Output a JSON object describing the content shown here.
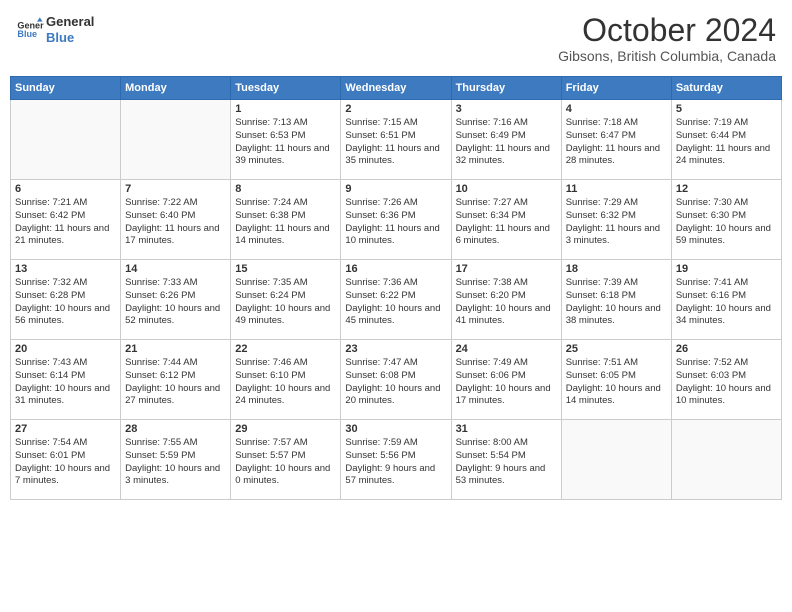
{
  "header": {
    "logo_line1": "General",
    "logo_line2": "Blue",
    "month": "October 2024",
    "location": "Gibsons, British Columbia, Canada"
  },
  "weekdays": [
    "Sunday",
    "Monday",
    "Tuesday",
    "Wednesday",
    "Thursday",
    "Friday",
    "Saturday"
  ],
  "weeks": [
    [
      {
        "day": "",
        "info": ""
      },
      {
        "day": "",
        "info": ""
      },
      {
        "day": "1",
        "info": "Sunrise: 7:13 AM\nSunset: 6:53 PM\nDaylight: 11 hours and 39 minutes."
      },
      {
        "day": "2",
        "info": "Sunrise: 7:15 AM\nSunset: 6:51 PM\nDaylight: 11 hours and 35 minutes."
      },
      {
        "day": "3",
        "info": "Sunrise: 7:16 AM\nSunset: 6:49 PM\nDaylight: 11 hours and 32 minutes."
      },
      {
        "day": "4",
        "info": "Sunrise: 7:18 AM\nSunset: 6:47 PM\nDaylight: 11 hours and 28 minutes."
      },
      {
        "day": "5",
        "info": "Sunrise: 7:19 AM\nSunset: 6:44 PM\nDaylight: 11 hours and 24 minutes."
      }
    ],
    [
      {
        "day": "6",
        "info": "Sunrise: 7:21 AM\nSunset: 6:42 PM\nDaylight: 11 hours and 21 minutes."
      },
      {
        "day": "7",
        "info": "Sunrise: 7:22 AM\nSunset: 6:40 PM\nDaylight: 11 hours and 17 minutes."
      },
      {
        "day": "8",
        "info": "Sunrise: 7:24 AM\nSunset: 6:38 PM\nDaylight: 11 hours and 14 minutes."
      },
      {
        "day": "9",
        "info": "Sunrise: 7:26 AM\nSunset: 6:36 PM\nDaylight: 11 hours and 10 minutes."
      },
      {
        "day": "10",
        "info": "Sunrise: 7:27 AM\nSunset: 6:34 PM\nDaylight: 11 hours and 6 minutes."
      },
      {
        "day": "11",
        "info": "Sunrise: 7:29 AM\nSunset: 6:32 PM\nDaylight: 11 hours and 3 minutes."
      },
      {
        "day": "12",
        "info": "Sunrise: 7:30 AM\nSunset: 6:30 PM\nDaylight: 10 hours and 59 minutes."
      }
    ],
    [
      {
        "day": "13",
        "info": "Sunrise: 7:32 AM\nSunset: 6:28 PM\nDaylight: 10 hours and 56 minutes."
      },
      {
        "day": "14",
        "info": "Sunrise: 7:33 AM\nSunset: 6:26 PM\nDaylight: 10 hours and 52 minutes."
      },
      {
        "day": "15",
        "info": "Sunrise: 7:35 AM\nSunset: 6:24 PM\nDaylight: 10 hours and 49 minutes."
      },
      {
        "day": "16",
        "info": "Sunrise: 7:36 AM\nSunset: 6:22 PM\nDaylight: 10 hours and 45 minutes."
      },
      {
        "day": "17",
        "info": "Sunrise: 7:38 AM\nSunset: 6:20 PM\nDaylight: 10 hours and 41 minutes."
      },
      {
        "day": "18",
        "info": "Sunrise: 7:39 AM\nSunset: 6:18 PM\nDaylight: 10 hours and 38 minutes."
      },
      {
        "day": "19",
        "info": "Sunrise: 7:41 AM\nSunset: 6:16 PM\nDaylight: 10 hours and 34 minutes."
      }
    ],
    [
      {
        "day": "20",
        "info": "Sunrise: 7:43 AM\nSunset: 6:14 PM\nDaylight: 10 hours and 31 minutes."
      },
      {
        "day": "21",
        "info": "Sunrise: 7:44 AM\nSunset: 6:12 PM\nDaylight: 10 hours and 27 minutes."
      },
      {
        "day": "22",
        "info": "Sunrise: 7:46 AM\nSunset: 6:10 PM\nDaylight: 10 hours and 24 minutes."
      },
      {
        "day": "23",
        "info": "Sunrise: 7:47 AM\nSunset: 6:08 PM\nDaylight: 10 hours and 20 minutes."
      },
      {
        "day": "24",
        "info": "Sunrise: 7:49 AM\nSunset: 6:06 PM\nDaylight: 10 hours and 17 minutes."
      },
      {
        "day": "25",
        "info": "Sunrise: 7:51 AM\nSunset: 6:05 PM\nDaylight: 10 hours and 14 minutes."
      },
      {
        "day": "26",
        "info": "Sunrise: 7:52 AM\nSunset: 6:03 PM\nDaylight: 10 hours and 10 minutes."
      }
    ],
    [
      {
        "day": "27",
        "info": "Sunrise: 7:54 AM\nSunset: 6:01 PM\nDaylight: 10 hours and 7 minutes."
      },
      {
        "day": "28",
        "info": "Sunrise: 7:55 AM\nSunset: 5:59 PM\nDaylight: 10 hours and 3 minutes."
      },
      {
        "day": "29",
        "info": "Sunrise: 7:57 AM\nSunset: 5:57 PM\nDaylight: 10 hours and 0 minutes."
      },
      {
        "day": "30",
        "info": "Sunrise: 7:59 AM\nSunset: 5:56 PM\nDaylight: 9 hours and 57 minutes."
      },
      {
        "day": "31",
        "info": "Sunrise: 8:00 AM\nSunset: 5:54 PM\nDaylight: 9 hours and 53 minutes."
      },
      {
        "day": "",
        "info": ""
      },
      {
        "day": "",
        "info": ""
      }
    ]
  ]
}
